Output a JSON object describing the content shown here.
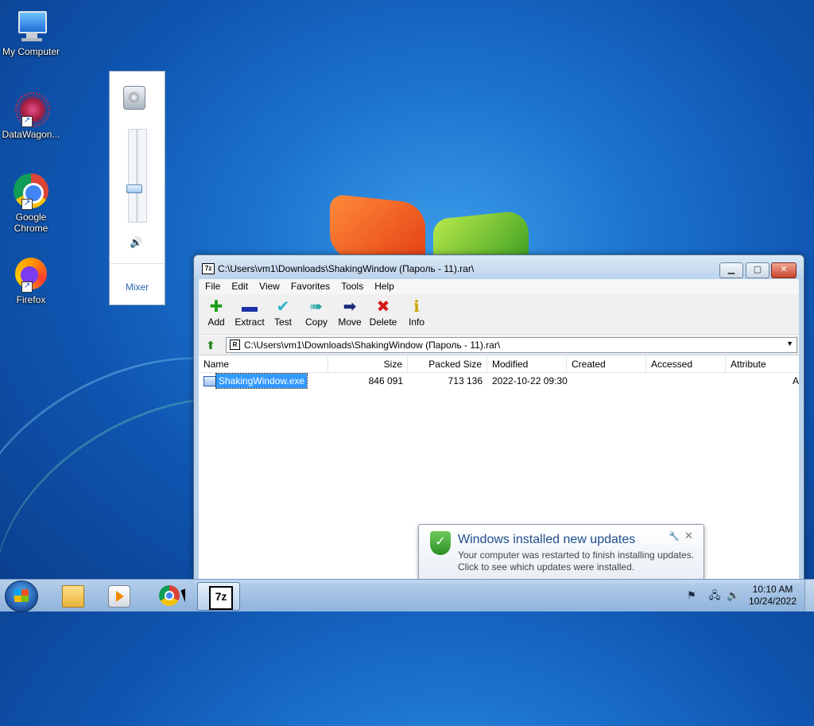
{
  "desktop": {
    "icons": [
      {
        "label": "My Computer"
      },
      {
        "label": "DataWagon..."
      },
      {
        "label_line1": "Google",
        "label_line2": "Chrome"
      },
      {
        "label": "Firefox"
      }
    ]
  },
  "volume": {
    "mixer_label": "Mixer",
    "level_fraction": 0.35,
    "speaker_icon": "speaker-icon",
    "mute_icon": "speaker-sound-icon"
  },
  "window": {
    "title": "C:\\Users\\vm1\\Downloads\\ShakingWindow (Пароль - 11).rar\\",
    "menu": [
      "File",
      "Edit",
      "View",
      "Favorites",
      "Tools",
      "Help"
    ],
    "toolbar": [
      {
        "label": "Add",
        "icon": "plus-icon",
        "color": "#1aa01a"
      },
      {
        "label": "Extract",
        "icon": "minus-icon",
        "color": "#1b2fa8"
      },
      {
        "label": "Test",
        "icon": "check-icon",
        "color": "#2fb6c9"
      },
      {
        "label": "Copy",
        "icon": "double-arrow-icon",
        "color": "#2aa7a7"
      },
      {
        "label": "Move",
        "icon": "arrow-right-icon",
        "color": "#1b2a7a"
      },
      {
        "label": "Delete",
        "icon": "x-icon",
        "color": "#d21a1a"
      },
      {
        "label": "Info",
        "icon": "info-icon",
        "color": "#c9a800"
      }
    ],
    "address": "C:\\Users\\vm1\\Downloads\\ShakingWindow (Пароль - 11).rar\\",
    "columns": [
      "Name",
      "Size",
      "Packed Size",
      "Modified",
      "Created",
      "Accessed",
      "Attribute"
    ],
    "files": [
      {
        "name": "ShakingWindow.exe",
        "size": "846 091",
        "packed": "713 136",
        "modified": "2022-10-22 09:30",
        "created": "",
        "accessed": "",
        "attr": "A"
      }
    ]
  },
  "notification": {
    "title": "Windows installed new updates",
    "line1": "Your computer was restarted to finish installing updates.",
    "line2": "Click to see which updates were installed."
  },
  "taskbar": {
    "sevenzip_label": "7z",
    "time": "10:10 AM",
    "date": "10/24/2022"
  }
}
